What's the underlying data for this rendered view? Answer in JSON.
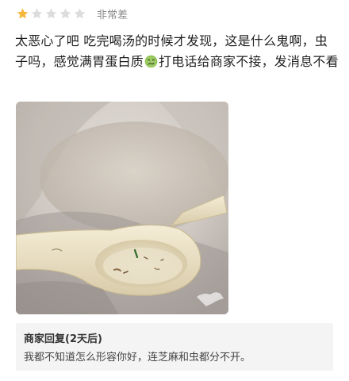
{
  "rating": {
    "stars_total": 5,
    "stars_filled": 1,
    "label": "非常差",
    "filled_color": "#f6b73c",
    "empty_color": "#dcdcdc"
  },
  "review": {
    "text_before_emoji": "太恶心了吧 吃完喝汤的时候才发现，这是什么鬼啊，虫子吗，感觉满胃蛋白质",
    "emoji_icon": "nauseated-face-icon",
    "text_after_emoji": "打电话给商家不接，发消息不看"
  },
  "photo": {
    "subject": "soup-spoon-photo"
  },
  "merchant_reply": {
    "title": "商家回复(2天后)",
    "text": "我都不知道怎么形容你好，连芝麻和虫都分不开。"
  }
}
